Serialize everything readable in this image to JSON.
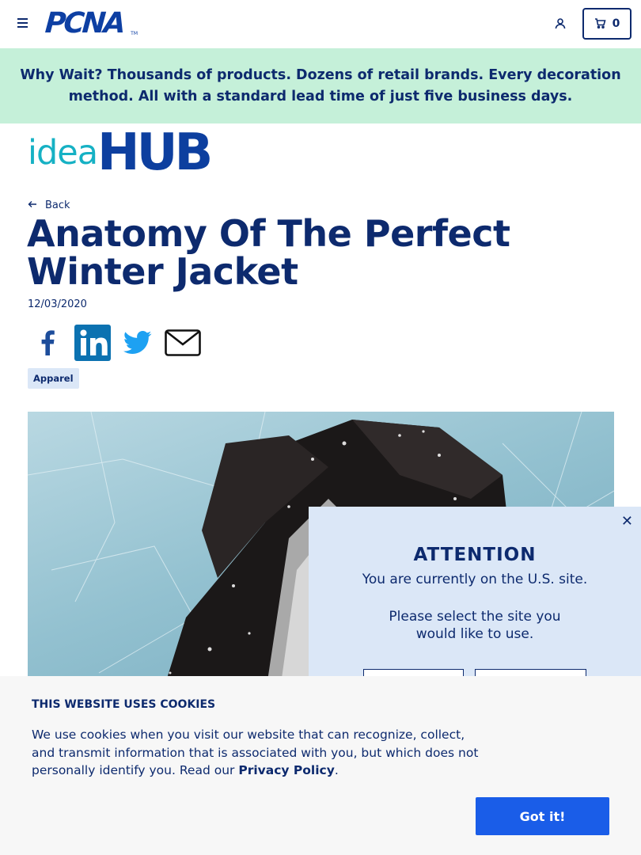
{
  "header": {
    "logo_text": "PCNA",
    "logo_tm": "TM",
    "cart_count": "0",
    "icons": {
      "menu": "hamburger-menu-icon",
      "user": "user-icon",
      "cart": "cart-icon"
    }
  },
  "banner": {
    "lead_in": "Why Wait?",
    "text": " Thousands of products. Dozens of retail brands. Every decoration method. All with a standard lead time of just five business days.",
    "background": "#c5f0d9"
  },
  "idea_hub": {
    "idea": "idea",
    "hub": "HUB"
  },
  "article": {
    "back_label": "Back",
    "title": "Anatomy Of The Perfect Winter Jacket",
    "date": "12/03/2020",
    "share_icons": [
      "facebook-icon",
      "linkedin-icon",
      "twitter-icon",
      "email-icon"
    ],
    "tag": "Apparel"
  },
  "attention_modal": {
    "heading": "ATTENTION",
    "line1": "You are currently on the U.S. site.",
    "line2": "Please select the site you would like to use."
  },
  "cookie_banner": {
    "heading": "THIS WEBSITE USES COOKIES",
    "body": "We use cookies when you visit our website that can recognize, collect, and transmit information that is associated with you, but which does not personally identify you. Read our ",
    "link": "Privacy Policy",
    "suffix": ".",
    "button": "Got it!",
    "button_color": "#1a5de8"
  },
  "colors": {
    "navy": "#0d2a6e",
    "brand_blue": "#0d3fa3",
    "teal": "#16b1c4",
    "modal_bg": "#dbe7f7"
  }
}
